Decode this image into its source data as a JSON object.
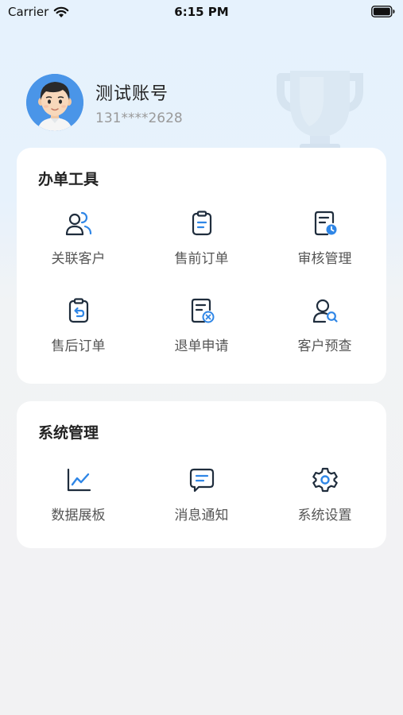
{
  "status_bar": {
    "carrier": "Carrier",
    "time": "6:15 PM",
    "icons": [
      "wifi-icon",
      "battery-icon"
    ]
  },
  "profile": {
    "name": "测试账号",
    "phone": "131****2628",
    "avatar": "avatar-boy",
    "decor": "trophy-icon"
  },
  "tools": {
    "title": "办单工具",
    "items": [
      {
        "label": "关联客户",
        "icon": "link-customer-icon"
      },
      {
        "label": "售前订单",
        "icon": "clipboard-list-icon"
      },
      {
        "label": "审核管理",
        "icon": "document-clock-icon"
      },
      {
        "label": "售后订单",
        "icon": "clipboard-return-icon"
      },
      {
        "label": "退单申请",
        "icon": "document-cancel-icon"
      },
      {
        "label": "客户预查",
        "icon": "user-search-icon"
      }
    ]
  },
  "system": {
    "title": "系统管理",
    "items": [
      {
        "label": "数据展板",
        "icon": "line-chart-icon"
      },
      {
        "label": "消息通知",
        "icon": "message-icon"
      },
      {
        "label": "系统设置",
        "icon": "gear-icon"
      }
    ]
  },
  "colors": {
    "icon_dark": "#1f2d3d",
    "icon_accent": "#2f86e6",
    "label": "#555555",
    "card_bg": "#ffffff"
  }
}
